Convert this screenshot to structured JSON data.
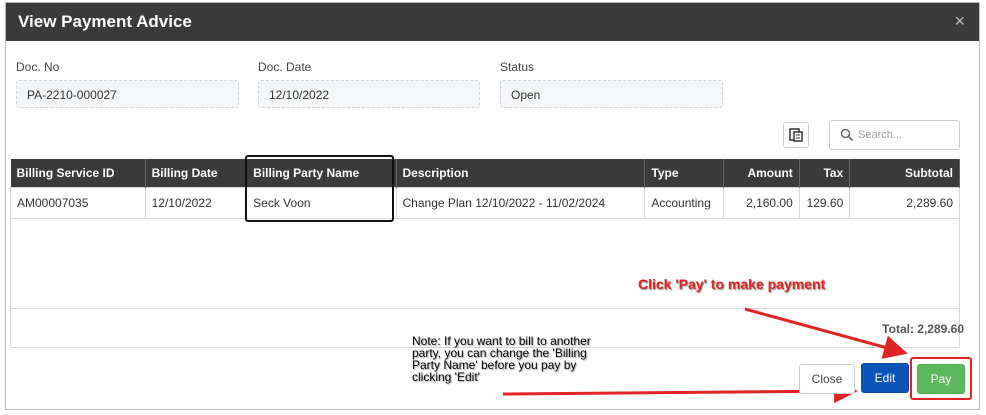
{
  "modal": {
    "title": "View Payment Advice",
    "close_glyph": "×"
  },
  "fields": {
    "doc_no": {
      "label": "Doc. No",
      "value": "PA-2210-000027"
    },
    "doc_date": {
      "label": "Doc. Date",
      "value": "12/10/2022"
    },
    "status": {
      "label": "Status",
      "value": "Open"
    }
  },
  "toolbar": {
    "export_icon": "export-grid-icon",
    "search_icon": "search-icon",
    "search_placeholder": "Search..."
  },
  "table": {
    "headers": [
      "Billing Service ID",
      "Billing Date",
      "Billing Party Name",
      "Description",
      "Type",
      "Amount",
      "Tax",
      "Subtotal"
    ],
    "rows": [
      [
        "AM00007035",
        "12/10/2022",
        "Seck Voon",
        "Change Plan 12/10/2022 - 11/02/2024",
        "Accounting",
        "2,160.00",
        "129.60",
        "2,289.60"
      ]
    ]
  },
  "total": "Total: 2,289.60",
  "buttons": {
    "close": "Close",
    "edit": "Edit",
    "pay": "Pay"
  },
  "annotations": {
    "pay_hint": "Click 'Pay' to make payment",
    "note_lines": [
      "Note: If you want to bill to another",
      "party, you can change the 'Billing",
      "Party Name' before you pay by",
      "clicking 'Edit'"
    ],
    "color": "#e02424"
  },
  "colors": {
    "header_bg": "#3a3a3a",
    "edit_btn": "#0b55b8",
    "pay_btn": "#5cb85c"
  }
}
